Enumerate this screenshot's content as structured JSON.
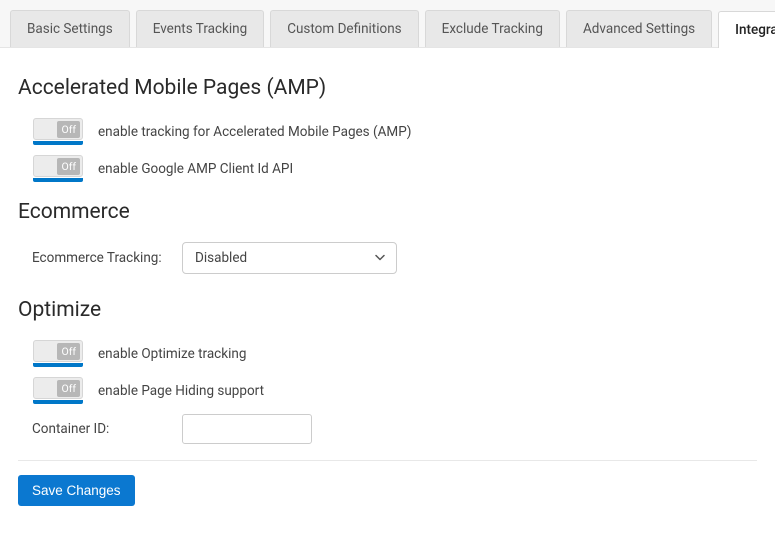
{
  "tabs": {
    "basic": "Basic Settings",
    "events": "Events Tracking",
    "custom": "Custom Definitions",
    "exclude": "Exclude Tracking",
    "advanced": "Advanced Settings",
    "integration": "Integration"
  },
  "sections": {
    "amp": {
      "title": "Accelerated Mobile Pages (AMP)",
      "toggle1": {
        "state": "Off",
        "desc": "enable tracking for Accelerated Mobile Pages (AMP)"
      },
      "toggle2": {
        "state": "Off",
        "desc": "enable Google AMP Client Id API"
      }
    },
    "ecommerce": {
      "title": "Ecommerce",
      "tracking_label": "Ecommerce Tracking:",
      "tracking_value": "Disabled"
    },
    "optimize": {
      "title": "Optimize",
      "toggle1": {
        "state": "Off",
        "desc": "enable Optimize tracking"
      },
      "toggle2": {
        "state": "Off",
        "desc": "enable Page Hiding support"
      },
      "container_label": "Container ID:",
      "container_value": ""
    }
  },
  "actions": {
    "save": "Save Changes"
  }
}
